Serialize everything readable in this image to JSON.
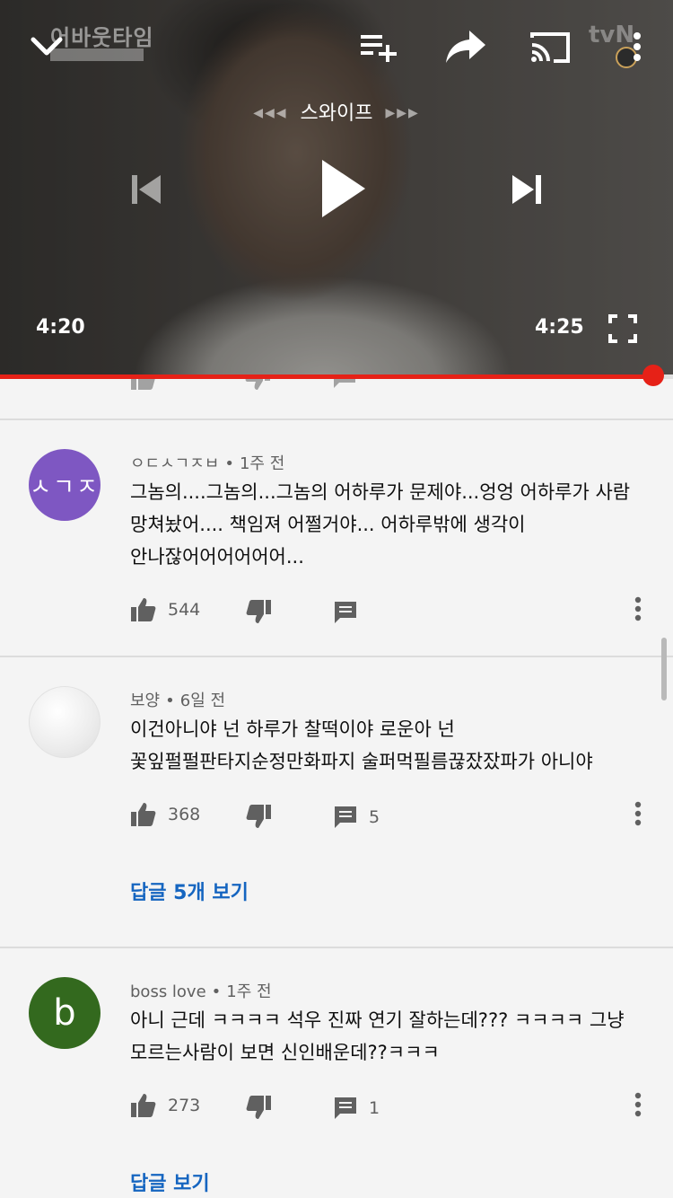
{
  "player": {
    "watermark_left": "어바웃타임",
    "watermark_right": "tvN",
    "swipe_label": "스와이프",
    "current_time": "4:20",
    "duration": "4:25",
    "progress_fraction": 0.97,
    "accent_color": "#e62117",
    "icons": [
      "chevron-down-icon",
      "add-to-playlist-icon",
      "share-icon",
      "cast-icon",
      "more-vert-icon",
      "previous-icon",
      "play-icon",
      "next-icon",
      "fullscreen-icon"
    ]
  },
  "comments": [
    {
      "avatar_text": "ㅅㄱㅈ",
      "avatar_color": "#7e57c2",
      "author": "ㅇㄷㅅㄱㅈㅂ",
      "age": "1주 전",
      "text": "그놈의....그놈의...그놈의 어하루가 문제야...엉엉 어하루가 사람 망쳐놨어.... 책임져 어쩔거야... 어하루밖에 생각이 안나잖어어어어어어...",
      "likes": "544",
      "reply_count": ""
    },
    {
      "avatar_text": "",
      "avatar_color": "#f2f2f2",
      "author": "보양",
      "age": "6일 전",
      "text": "이건아니야 넌 하루가 찰떡이야 로운아 넌 꽃잎펄펄판타지순정만화파지 술퍼먹필름끊잤잤파가 아니야",
      "likes": "368",
      "reply_count": "5",
      "replies_link": "답글 5개 보기"
    },
    {
      "avatar_text": "b",
      "avatar_color": "#33691e",
      "author": "boss love",
      "age": "1주 전",
      "text": "아니 근데 ㅋㅋㅋㅋ 석우 진짜 연기 잘하는데??? ㅋㅋㅋㅋ 그냥 모르는사람이 보면 신인배운데??ㅋㅋㅋ",
      "likes": "273",
      "reply_count": "1",
      "replies_link": "답글 보기"
    }
  ],
  "separator_dot": "•"
}
